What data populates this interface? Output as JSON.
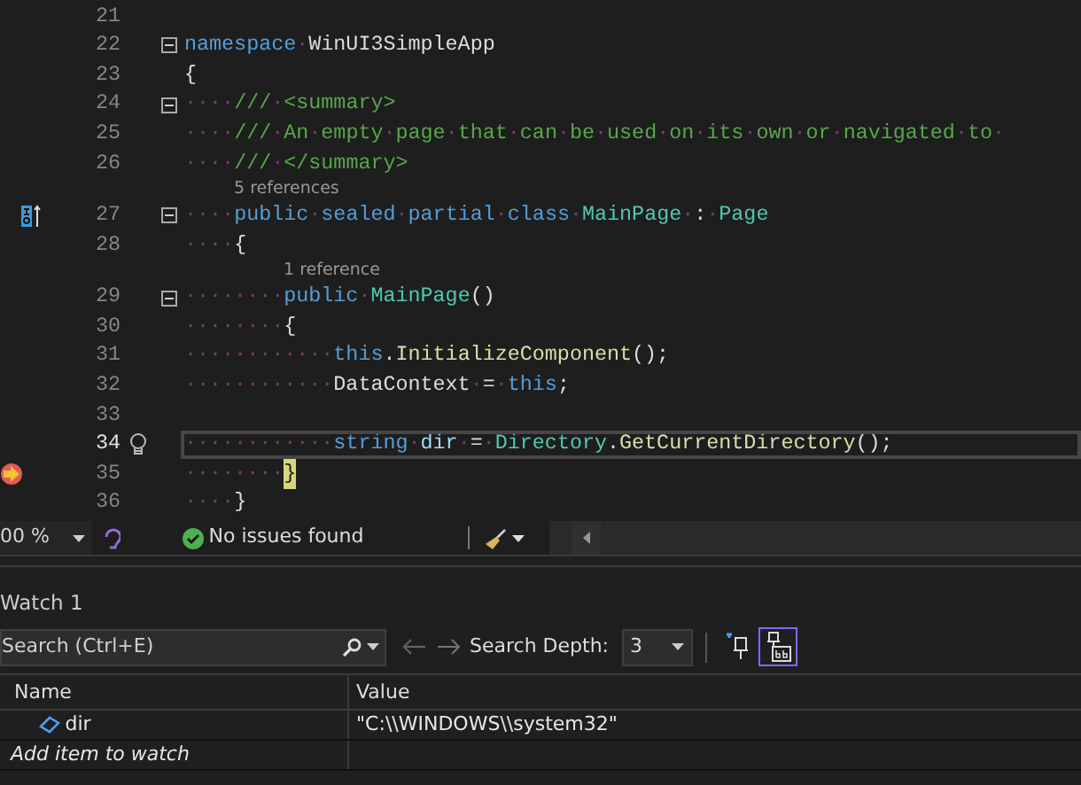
{
  "editor": {
    "lines": [
      {
        "number": "21"
      },
      {
        "number": "22",
        "fold": true,
        "tokens": [
          {
            "text": "namespace",
            "kind": "keyword"
          },
          {
            "text": "·WinUI3SimpleApp",
            "kind": "plain"
          }
        ]
      },
      {
        "number": "23",
        "tokens": [
          {
            "text": "{",
            "kind": "plain"
          }
        ]
      },
      {
        "number": "24",
        "fold": true,
        "tokens": [
          {
            "text": "····",
            "kind": "plain"
          },
          {
            "text": "///·<summary>",
            "kind": "comment"
          }
        ]
      },
      {
        "number": "25",
        "tokens": [
          {
            "text": "····",
            "kind": "plain"
          },
          {
            "text": "///·An·empty·page·that·can·be·used·on·its·own·or·navigated·to·",
            "kind": "comment"
          }
        ]
      },
      {
        "number": "26",
        "tokens": [
          {
            "text": "····",
            "kind": "plain"
          },
          {
            "text": "///·</summary>",
            "kind": "comment"
          }
        ]
      },
      {
        "number": "27",
        "fold": true,
        "references": "5 references",
        "implements_marker": true,
        "tokens": [
          {
            "text": "····",
            "kind": "plain"
          },
          {
            "text": "public·sealed·partial·class",
            "kind": "keyword"
          },
          {
            "text": "·",
            "kind": "plain"
          },
          {
            "text": "MainPage",
            "kind": "type"
          },
          {
            "text": "·:·",
            "kind": "plain"
          },
          {
            "text": "Page",
            "kind": "type"
          }
        ]
      },
      {
        "number": "28",
        "tokens": [
          {
            "text": "····{",
            "kind": "plain"
          }
        ]
      },
      {
        "number": "29",
        "fold": true,
        "references": "1 reference",
        "tokens": [
          {
            "text": "········",
            "kind": "plain"
          },
          {
            "text": "public",
            "kind": "keyword"
          },
          {
            "text": "·",
            "kind": "plain"
          },
          {
            "text": "MainPage",
            "kind": "type"
          },
          {
            "text": "()",
            "kind": "plain"
          }
        ]
      },
      {
        "number": "30",
        "tokens": [
          {
            "text": "········{",
            "kind": "plain"
          }
        ]
      },
      {
        "number": "31",
        "tokens": [
          {
            "text": "············",
            "kind": "plain"
          },
          {
            "text": "this",
            "kind": "keyword"
          },
          {
            "text": ".",
            "kind": "plain"
          },
          {
            "text": "InitializeComponent",
            "kind": "method"
          },
          {
            "text": "();",
            "kind": "plain"
          }
        ]
      },
      {
        "number": "32",
        "tokens": [
          {
            "text": "············DataContext·=·",
            "kind": "plain"
          },
          {
            "text": "this",
            "kind": "keyword"
          },
          {
            "text": ";",
            "kind": "plain"
          }
        ]
      },
      {
        "number": "33"
      },
      {
        "number": "34",
        "caret_line": true,
        "lightbulb": true,
        "tokens": [
          {
            "text": "············",
            "kind": "plain"
          },
          {
            "text": "string",
            "kind": "keyword"
          },
          {
            "text": "·",
            "kind": "plain"
          },
          {
            "text": "dir",
            "kind": "variable"
          },
          {
            "text": "·=·",
            "kind": "plain"
          },
          {
            "text": "Directory",
            "kind": "type"
          },
          {
            "text": ".",
            "kind": "plain"
          },
          {
            "text": "GetCurrentDirectory",
            "kind": "method"
          },
          {
            "text": "();",
            "kind": "plain"
          }
        ]
      },
      {
        "number": "35",
        "tokens": [
          {
            "text": "········",
            "kind": "plain"
          },
          {
            "text": "}",
            "kind": "plain",
            "execution_point": true
          }
        ]
      },
      {
        "number": "36",
        "tokens": [
          {
            "text": "····}",
            "kind": "plain"
          }
        ]
      }
    ]
  },
  "status_bar": {
    "zoom": "00 %",
    "issues": "No issues found"
  },
  "watch": {
    "title": "Watch 1",
    "search": {
      "placeholder": "Search (Ctrl+E)"
    },
    "depth_label": "Search Depth:",
    "depth_value": "3",
    "toggles": [
      {
        "kind": "pin-filter",
        "selected": false
      },
      {
        "kind": "pin-text",
        "selected": true
      }
    ],
    "columns": [
      "Name",
      "Value"
    ],
    "rows": [
      {
        "name": "dir",
        "value": "\"C:\\\\WINDOWS\\\\system32\""
      }
    ],
    "add_row": "Add item to watch"
  }
}
